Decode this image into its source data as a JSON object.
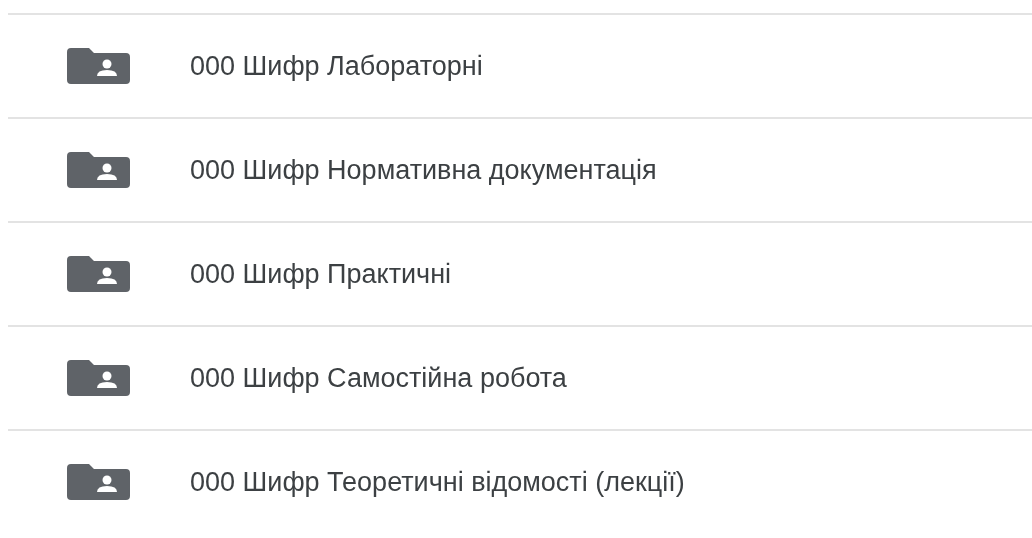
{
  "folders": [
    {
      "name": "000 Шифр Лабораторні"
    },
    {
      "name": "000 Шифр Нормативна документація"
    },
    {
      "name": "000 Шифр Практичні"
    },
    {
      "name": "000 Шифр Самостійна робота"
    },
    {
      "name": "000 Шифр Теоретичні відомості (лекції)"
    }
  ]
}
